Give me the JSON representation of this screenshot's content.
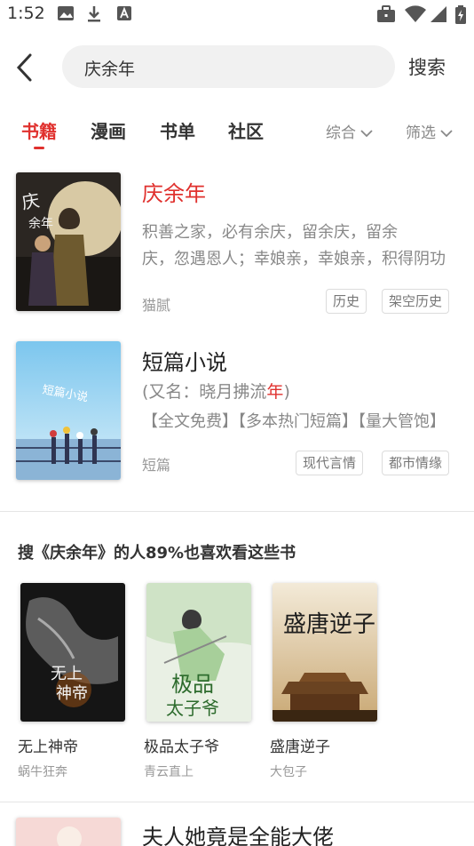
{
  "status_bar": {
    "time": "1:52",
    "icons": [
      "gallery-icon",
      "download-icon",
      "text-icon",
      "briefcase-icon",
      "wifi-icon",
      "signal-icon",
      "battery-icon"
    ]
  },
  "search": {
    "query": "庆余年",
    "button_label": "搜索"
  },
  "tabs": [
    {
      "label": "书籍",
      "active": true
    },
    {
      "label": "漫画",
      "active": false
    },
    {
      "label": "书单",
      "active": false
    },
    {
      "label": "社区",
      "active": false
    }
  ],
  "sort": {
    "label": "综合"
  },
  "filter": {
    "label": "筛选"
  },
  "results": [
    {
      "title": "庆余年",
      "desc_line1": "积善之家，必有余庆，留余庆，留余",
      "desc_line2": "庆，忽遇恩人；幸娘亲，幸娘亲，积得阴功",
      "author": "猫腻",
      "tags": [
        "历史",
        "架空历史"
      ]
    },
    {
      "title": "短篇小说",
      "alias_prefix": "(又名：晓月拂流",
      "alias_highlight": "年",
      "alias_suffix": ")",
      "desc_line1": "【全文免费】【多本热门短篇】【量大管饱】",
      "author": "短篇",
      "tags": [
        "现代言情",
        "都市情缘"
      ]
    }
  ],
  "recommend": {
    "title": "搜《庆余年》的人89%也喜欢看这些书",
    "books": [
      {
        "name": "无上神帝",
        "author": "蜗牛狂奔"
      },
      {
        "name": "极品太子爷",
        "author": "青云直上"
      },
      {
        "name": "盛唐逆子",
        "author": "大包子"
      }
    ]
  },
  "next_result": {
    "title": "夫人她竟是全能大佬"
  },
  "colors": {
    "accent": "#e0312e",
    "muted": "#888888"
  }
}
